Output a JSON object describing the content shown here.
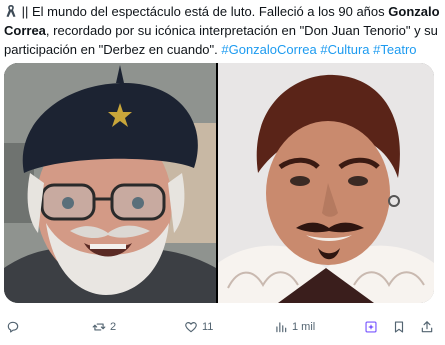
{
  "tweet": {
    "emoji_name": "black-ribbon-emoji",
    "text_pre": " || El mundo del espectáculo está de luto. Falleció a los 90 años ",
    "name_bold": "Gonzalo Correa",
    "text_mid": ", recordado por su icónica interpretación en \"Don Juan Tenorio\" y su participación en \"Derbez en cuando\". ",
    "hashtags": [
      "#GonzaloCorrea",
      "#Cultura",
      "#Teatro"
    ]
  },
  "media": {
    "photos": [
      {
        "icon": "photo-portrait-older-man-beret"
      },
      {
        "icon": "photo-portrait-man-stage-costume"
      }
    ]
  },
  "actions": {
    "reply_count": "",
    "retweet_count": "2",
    "like_count": "11",
    "views_count": "1 mil",
    "accent_color": "#7856ff",
    "muted_color": "#536471",
    "hashtag_color": "#1d9bf0"
  }
}
